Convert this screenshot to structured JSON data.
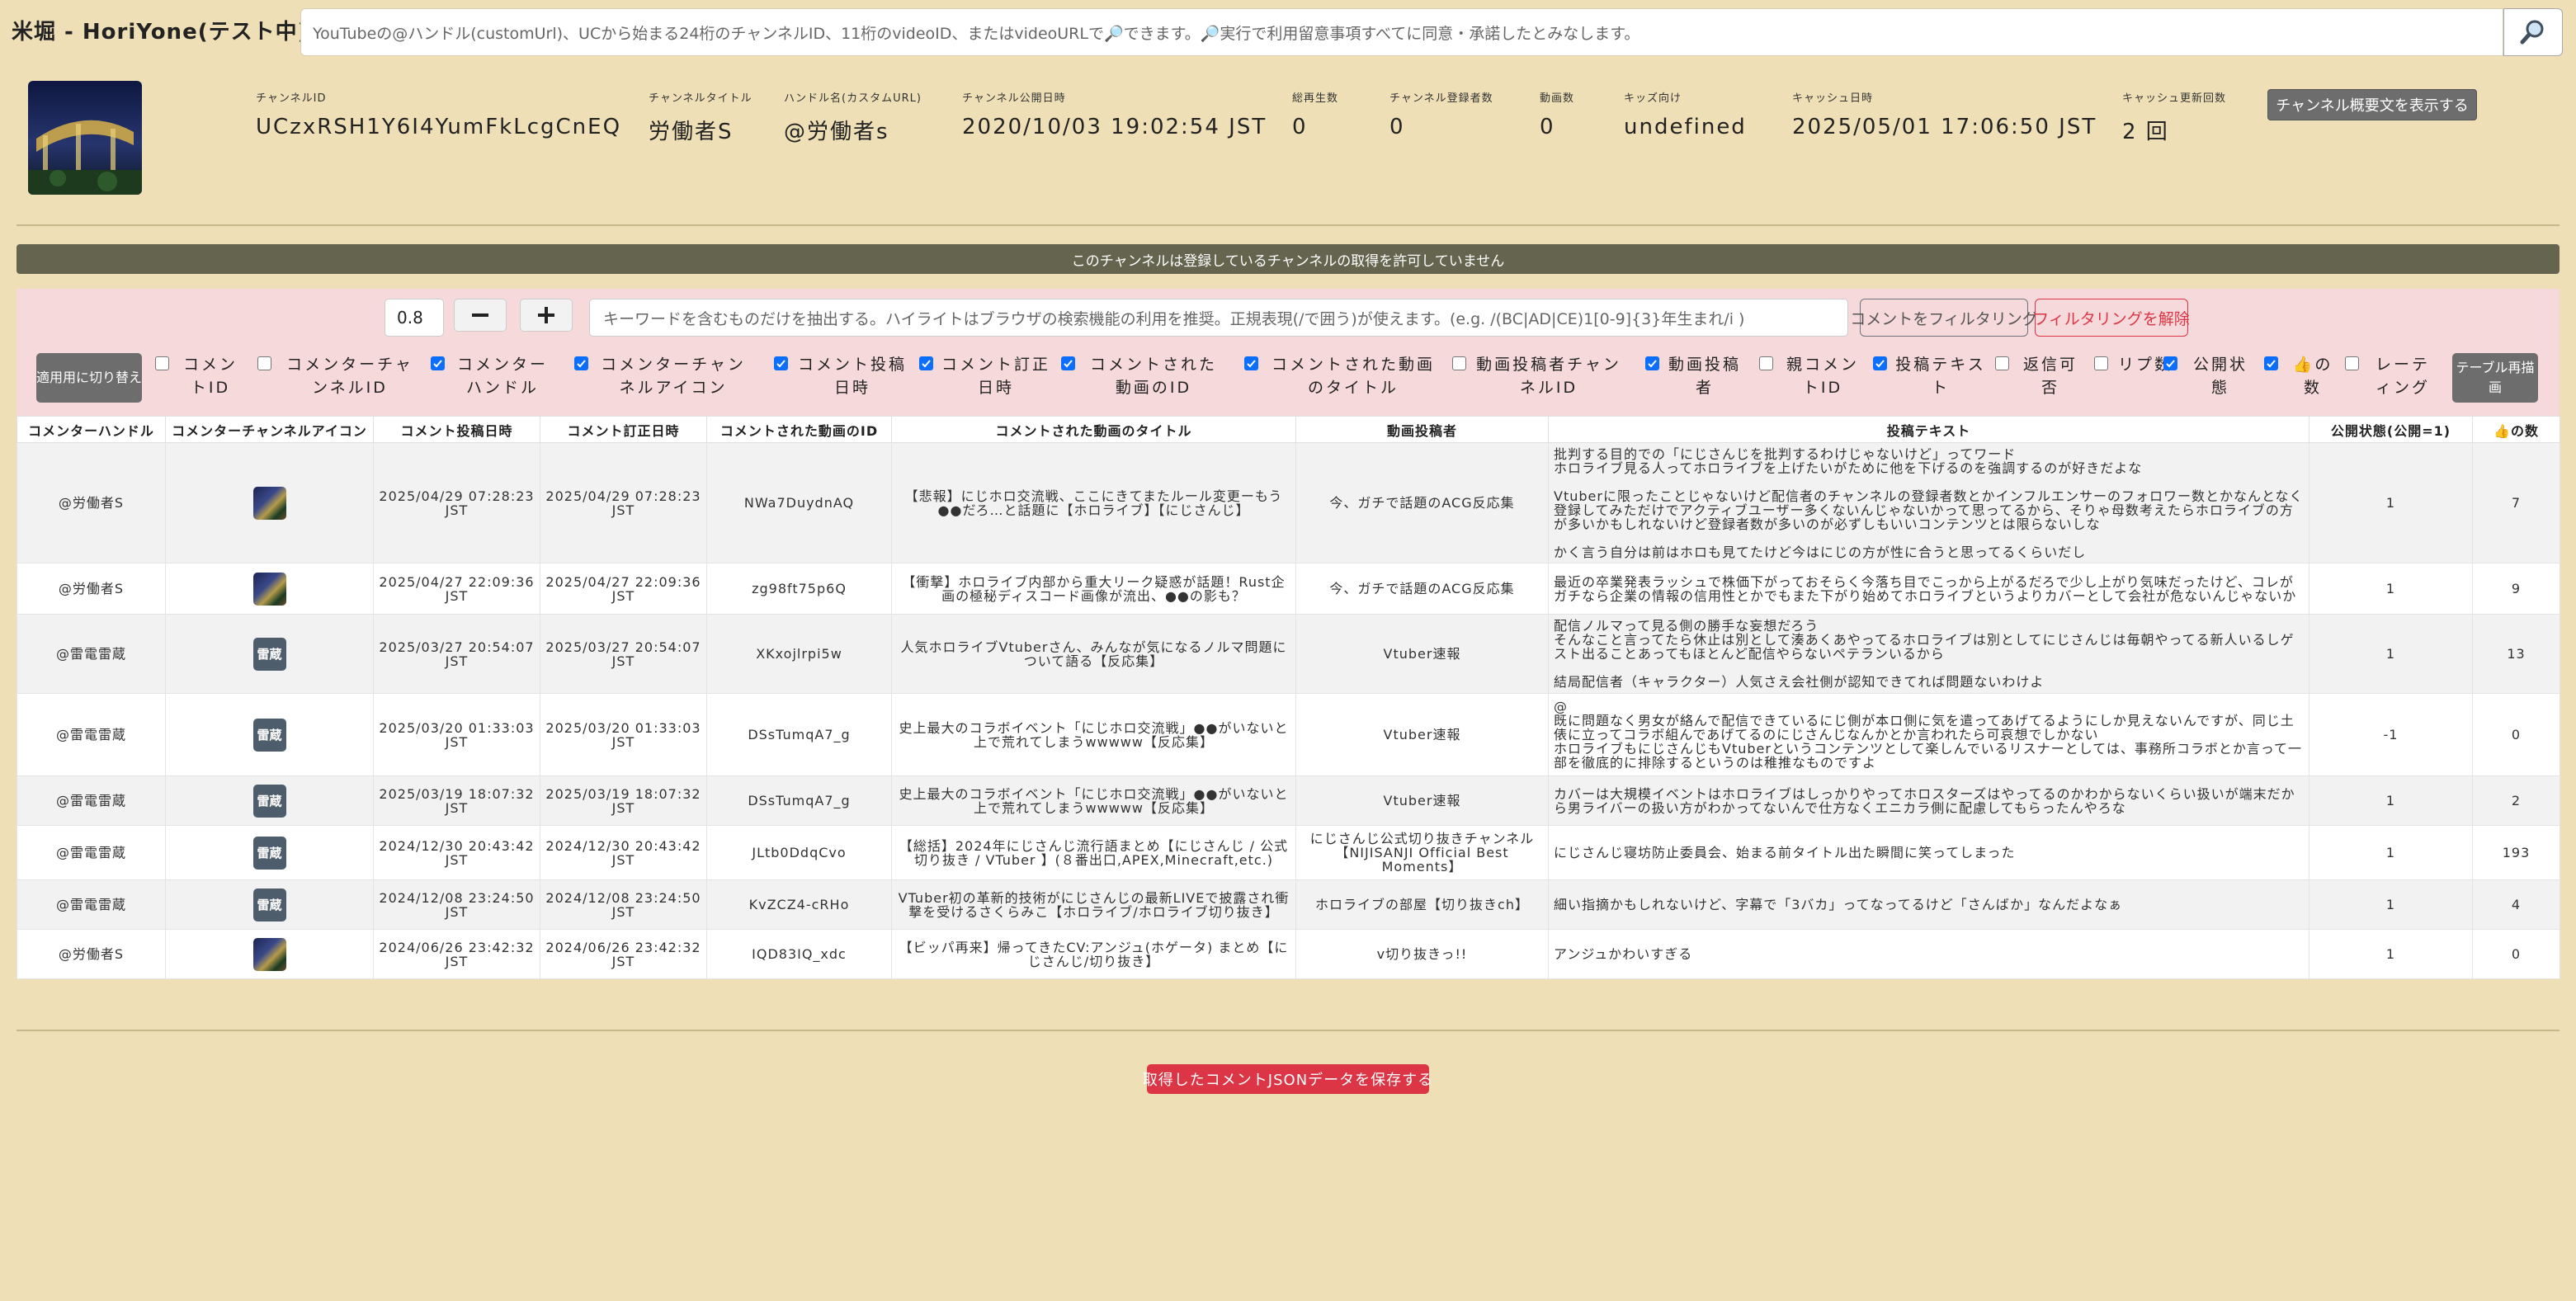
{
  "app": {
    "title": "米堀 - HoriYone(テスト中)"
  },
  "search": {
    "placeholder": "YouTubeの@ハンドル(customUrl)、UCから始まる24桁のチャンネルID、11桁のvideoID、またはvideoURLで🔎できます。🔎実行で利用留意事項すべてに同意・承諾したとみなします。",
    "button_icon": "magnifier-icon"
  },
  "channel": {
    "fields": [
      {
        "label": "チャンネルID",
        "value": "UCzxRSH1Y6I4YumFkLcgCnEQ"
      },
      {
        "label": "チャンネルタイトル",
        "value": "労働者S"
      },
      {
        "label": "ハンドル名(カスタムURL)",
        "value": "@労働者s"
      },
      {
        "label": "チャンネル公開日時",
        "value": "2020/10/03 19:02:54 JST"
      },
      {
        "label": "総再生数",
        "value": "0"
      },
      {
        "label": "チャンネル登録者数",
        "value": "0"
      },
      {
        "label": "動画数",
        "value": "0"
      },
      {
        "label": "キッズ向け",
        "value": "undefined"
      },
      {
        "label": "キャッシュ日時",
        "value": "2025/05/01 17:06:50 JST"
      },
      {
        "label": "キャッシュ更新回数",
        "value": "2 回"
      }
    ],
    "show_description_label": "チャンネル概要文を表示する"
  },
  "notice": "このチャンネルは登録しているチャンネルの取得を許可していません",
  "filter": {
    "zoom_value": "0.8",
    "keyword_placeholder": "キーワードを含むものだけを抽出する。ハイライトはブラウザの検索機能の利用を推奨。正規表現(/で囲う)が使えます。(e.g. /(BC|AD|CE)1[0-9]{3}年生まれ/i )",
    "filter_button": "コメントをフィルタリング",
    "clear_button": "フィルタリングを解除",
    "mobile_toggle": "適用用に切り替え",
    "redraw_button": "テーブル再描画",
    "columns": [
      {
        "label": "コメントID",
        "checked": false
      },
      {
        "label": "コメンターチャンネルID",
        "checked": false
      },
      {
        "label": "コメンターハンドル",
        "checked": true
      },
      {
        "label": "コメンターチャンネルアイコン",
        "checked": true
      },
      {
        "label": "コメント投稿日時",
        "checked": true
      },
      {
        "label": "コメント訂正日時",
        "checked": true
      },
      {
        "label": "コメントされた動画のID",
        "checked": true
      },
      {
        "label": "コメントされた動画のタイトル",
        "checked": true
      },
      {
        "label": "動画投稿者チャンネルID",
        "checked": false
      },
      {
        "label": "動画投稿者",
        "checked": true
      },
      {
        "label": "親コメントID",
        "checked": false
      },
      {
        "label": "投稿テキスト",
        "checked": true
      },
      {
        "label": "返信可否",
        "checked": false
      },
      {
        "label": "リプ数",
        "checked": false
      },
      {
        "label": "公開状態",
        "checked": true
      },
      {
        "label": "👍の数",
        "checked": true
      },
      {
        "label": "レーティング",
        "checked": false
      }
    ]
  },
  "table": {
    "headers": [
      "コメンターハンドル",
      "コメンターチャンネルアイコン",
      "コメント投稿日時",
      "コメント訂正日時",
      "コメントされた動画のID",
      "コメントされた動画のタイトル",
      "動画投稿者",
      "投稿テキスト",
      "公開状態(公開=1)",
      "👍の数"
    ],
    "rows": [
      {
        "handle": "@労働者S",
        "icon": "photo",
        "posted": "2025/04/29 07:28:23 JST",
        "edited": "2025/04/29 07:28:23 JST",
        "video_id": "NWa7DuydnAQ",
        "video_title": "【悲報】にじホロ交流戦、ここにきてまたルール変更ーもう●●だろ…と話題に【ホロライブ】【にじさんじ】",
        "uploader": "今、ガチで話題のACG反応集",
        "text": "批判する目的での「にじさんじを批判するわけじゃないけど」ってワード\nホロライブ見る人ってホロライブを上げたいがために他を下げるのを強調するのが好きだよな\n\nVtuberに限ったことじゃないけど配信者のチャンネルの登録者数とかインフルエンサーのフォロワー数とかなんとなく登録してみただけでアクティブユーザー多くないんじゃないかって思ってるから、そりゃ母数考えたらホロライブの方が多いかもしれないけど登録者数が多いのが必ずしもいいコンテンツとは限らないしな\n\nかく言う自分は前はホロも見てたけど今はにじの方が性に合うと思ってるくらいだし",
        "public": "1",
        "likes": "7"
      },
      {
        "handle": "@労働者S",
        "icon": "photo",
        "posted": "2025/04/27 22:09:36 JST",
        "edited": "2025/04/27 22:09:36 JST",
        "video_id": "zg98ft75p6Q",
        "video_title": "【衝撃】ホロライブ内部から重大リーク疑惑が話題！Rust企画の極秘ディスコード画像が流出、●●の影も？",
        "uploader": "今、ガチで話題のACG反応集",
        "text": "最近の卒業発表ラッシュで株価下がっておそらく今落ち目でこっから上がるだろで少し上がり気味だったけど、コレがガチなら企業の情報の信用性とかでもまた下がり始めてホロライブというよりカバーとして会社が危ないんじゃないか",
        "public": "1",
        "likes": "9"
      },
      {
        "handle": "@雷電雷蔵",
        "icon": "雷蔵",
        "posted": "2025/03/27 20:54:07 JST",
        "edited": "2025/03/27 20:54:07 JST",
        "video_id": "XKxojlrpi5w",
        "video_title": "人気ホロライブVtuberさん、みんなが気になるノルマ問題について語る【反応集】",
        "uploader": "Vtuber速報",
        "text": "配信ノルマって見る側の勝手な妄想だろう\nそんなこと言ってたら休止は別として湊あくあやってるホロライブは別としてにじさんじは毎朝やってる新人いるしゲスト出ることあってもほとんど配信やらないペテランいるから\n\n結局配信者（キャラクター）人気さえ会社側が認知できてれば問題ないわけよ",
        "public": "1",
        "likes": "13"
      },
      {
        "handle": "@雷電雷蔵",
        "icon": "雷蔵",
        "posted": "2025/03/20 01:33:03 JST",
        "edited": "2025/03/20 01:33:03 JST",
        "video_id": "DSsTumqA7_g",
        "video_title": "史上最大のコラボイベント「にじホロ交流戦」●●がいないと上で荒れてしまうwwwww【反応集】",
        "uploader": "Vtuber速報",
        "text": "@\n既に問題なく男女が絡んで配信できているにじ側が本ロ側に気を遣ってあげてるようにしか見えないんですが、同じ土俵に立ってコラボ組んであげてるのにじさんじなんかとか言われたら可哀想でしかない\nホロライブもにじさんじもVtuberというコンテンツとして楽しんでいるリスナーとしては、事務所コラボとか言って一部を徹底的に排除するというのは稚推なものですよ",
        "public": "-1",
        "likes": "0"
      },
      {
        "handle": "@雷電雷蔵",
        "icon": "雷蔵",
        "posted": "2025/03/19 18:07:32 JST",
        "edited": "2025/03/19 18:07:32 JST",
        "video_id": "DSsTumqA7_g",
        "video_title": "史上最大のコラボイベント「にじホロ交流戦」●●がいないと上で荒れてしまうwwwww【反応集】",
        "uploader": "Vtuber速報",
        "text": "カバーは大規模イベントはホロライブはしっかりやってホロスターズはやってるのかわからないくらい扱いが端末だから男ライバーの扱い方がわかってないんで仕方なくエニカラ側に配慮してもらったんやろな",
        "public": "1",
        "likes": "2"
      },
      {
        "handle": "@雷電雷蔵",
        "icon": "雷蔵",
        "posted": "2024/12/30 20:43:42 JST",
        "edited": "2024/12/30 20:43:42 JST",
        "video_id": "JLtb0DdqCvo",
        "video_title": "【総括】2024年にじさんじ流行語まとめ【にじさんじ / 公式切り抜き / VTuber 】(８番出口,APEX,Minecraft,etc.)",
        "uploader": "にじさんじ公式切り抜きチャンネル【NIJISANJI Official Best Moments】",
        "text": "にじさんじ寝坊防止委員会、始まる前タイトル出た瞬間に笑ってしまった",
        "public": "1",
        "likes": "193"
      },
      {
        "handle": "@雷電雷蔵",
        "icon": "雷蔵",
        "posted": "2024/12/08 23:24:50 JST",
        "edited": "2024/12/08 23:24:50 JST",
        "video_id": "KvZCZ4-cRHo",
        "video_title": "VTuber初の革新的技術がにじさんじの最新LIVEで披露され衝撃を受けるさくらみこ【ホロライブ/ホロライブ切り抜き】",
        "uploader": "ホロライブの部屋【切り抜きch】",
        "text": "細い指摘かもしれないけど、字幕で「3バカ」ってなってるけど「さんばか」なんだよなぁ",
        "public": "1",
        "likes": "4"
      },
      {
        "handle": "@労働者S",
        "icon": "photo",
        "posted": "2024/06/26 23:42:32 JST",
        "edited": "2024/06/26 23:42:32 JST",
        "video_id": "IQD83IQ_xdc",
        "video_title": "【ビッパ再来】帰ってきたCV:アンジュ(ホゲータ) まとめ【にじさんじ/切り抜き】",
        "uploader": "v切り抜きっ!!",
        "text": "アンジュかわいすぎる",
        "public": "1",
        "likes": "0"
      }
    ]
  },
  "footer": {
    "save_button": "取得したコメントJSONデータを保存する"
  }
}
